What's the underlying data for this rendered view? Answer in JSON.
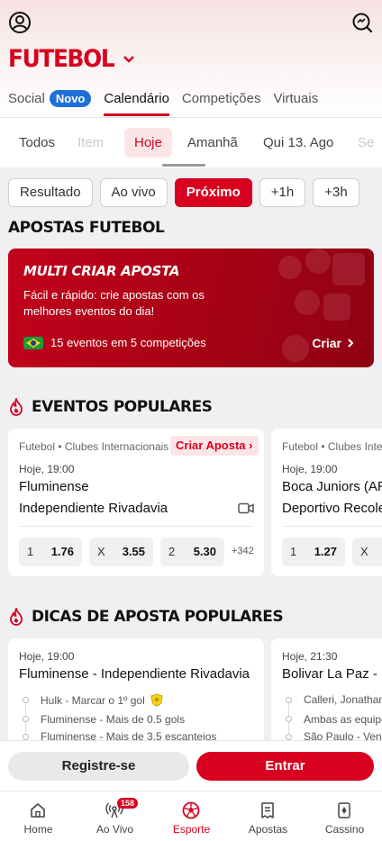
{
  "header": {
    "title": "FUTEBOL",
    "user_icon": "user-circle-icon",
    "search_icon": "search-icon"
  },
  "top_tabs": [
    {
      "label": "Social",
      "badge": "Novo"
    },
    {
      "label": "Calendário"
    },
    {
      "label": "Competições"
    },
    {
      "label": "Virtuais"
    }
  ],
  "date_tabs": [
    "Todos",
    "Item",
    "Hoje",
    "Amanhã",
    "Qui 13. Ago",
    "Se"
  ],
  "filters": [
    "Resultado",
    "Ao vivo",
    "Próximo",
    "+1h",
    "+3h"
  ],
  "sections": {
    "apostas": "APOSTAS FUTEBOL",
    "eventos": "EVENTOS POPULARES",
    "dicas": "DICAS DE APOSTA POPULARES"
  },
  "promo": {
    "title": "MULTI CRIAR APOSTA",
    "desc": "Fácil e rápido: crie apostas com os melhores eventos do dia!",
    "count": "15 eventos em 5 competições",
    "cta": "Criar"
  },
  "events": [
    {
      "league": "Futebol • Clubes Internacionais",
      "tag": "Criar Aposta",
      "time": "Hoje, 19:00",
      "home": "Fluminense",
      "away": "Independiente Rivadavia",
      "odds": [
        {
          "k": "1",
          "v": "1.76"
        },
        {
          "k": "X",
          "v": "3.55"
        },
        {
          "k": "2",
          "v": "5.30"
        }
      ],
      "more": "+342"
    },
    {
      "league": "Futebol • Clubes Internacionais",
      "time": "Hoje, 19:00",
      "home": "Boca Juniors (AR)",
      "away": "Deportivo Recoleta",
      "odds": [
        {
          "k": "1",
          "v": "1.27"
        },
        {
          "k": "X",
          "v": ""
        }
      ]
    }
  ],
  "dicas": [
    {
      "time": "Hoje, 19:00",
      "match": "Fluminense - Independiente Rivadavia",
      "selections": [
        "Hulk - Marcar o 1º gol",
        "Fluminense - Mais de 0.5 gols",
        "Fluminense - Mais de 3.5 escanteios"
      ]
    },
    {
      "time": "Hoje, 21:30",
      "match": "Bolivar La Paz - S",
      "selections": [
        "Calleri, Jonathan",
        "Ambas as equipes",
        "São Paulo - Vence"
      ]
    }
  ],
  "actions": {
    "register": "Registre-se",
    "login": "Entrar"
  },
  "bottom_nav": [
    {
      "label": "Home",
      "icon": "home-icon"
    },
    {
      "label": "Ao Vivo",
      "icon": "live-broadcast-icon",
      "badge": "158"
    },
    {
      "label": "Esporte",
      "icon": "soccer-ball-icon"
    },
    {
      "label": "Apostas",
      "icon": "betslip-icon"
    },
    {
      "label": "Cassino",
      "icon": "cards-icon"
    }
  ],
  "colors": {
    "brand": "#d8001e",
    "badge_blue": "#1e6fd9"
  }
}
